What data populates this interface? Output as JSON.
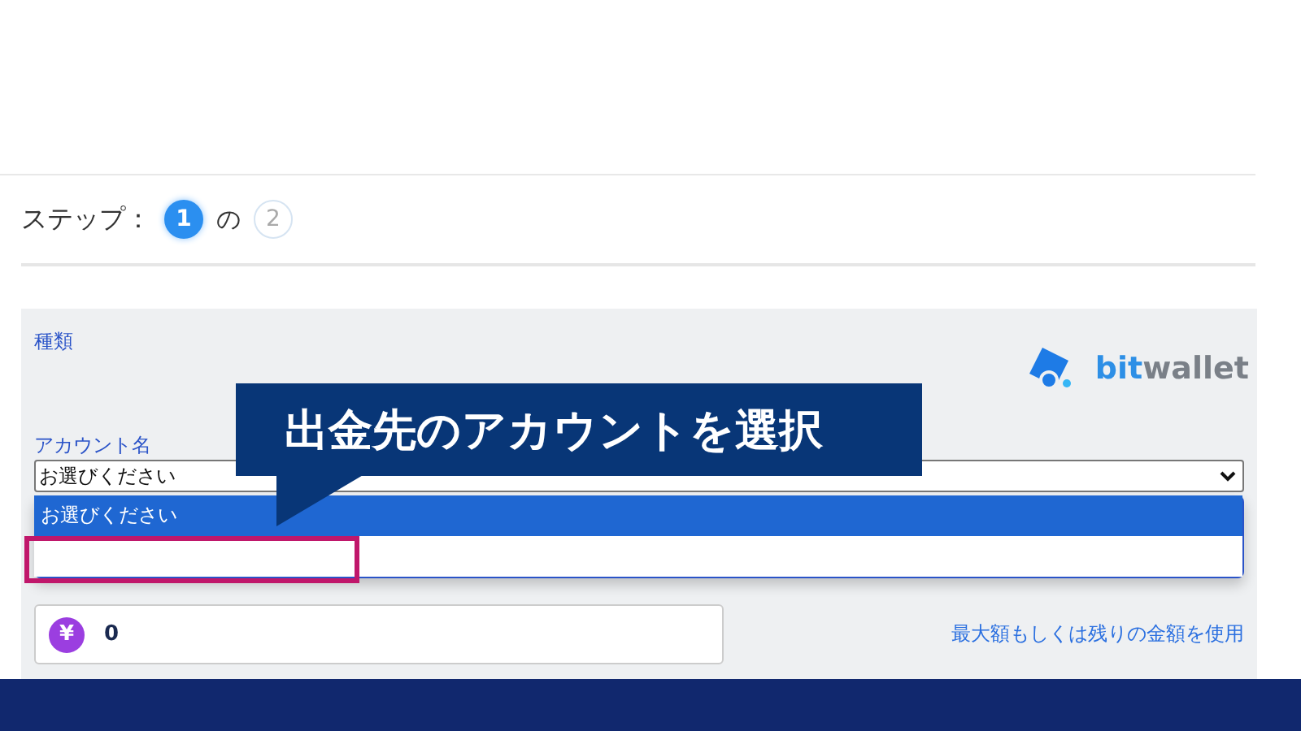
{
  "steps": {
    "label": "ステップ：",
    "connector": "の",
    "items": [
      {
        "number": "1",
        "selected": true
      },
      {
        "number": "2",
        "selected": false
      }
    ]
  },
  "form": {
    "type_label": "種類",
    "logo_prefix": "bit",
    "logo_suffix": "wallet",
    "account_label": "アカウント名",
    "account_value": "お選びください",
    "options": [
      {
        "label": "お選びください",
        "selected": true,
        "highlighted": false
      },
      {
        "selected": false,
        "highlighted": true
      }
    ],
    "currency_symbol": "¥",
    "amount_value": "0",
    "max_link": "最大額もしくは残りの金額を使用"
  },
  "callout": {
    "text": "出金先のアカウントを選択"
  }
}
